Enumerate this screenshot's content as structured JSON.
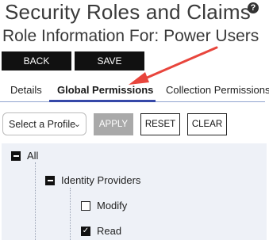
{
  "header": {
    "title": "Security Roles and Claims",
    "help_icon": "?",
    "subtitle": "Role Information For: Power Users"
  },
  "actions": {
    "back_label": "BACK",
    "save_label": "SAVE"
  },
  "tabs": [
    {
      "label": "Details",
      "active": false
    },
    {
      "label": "Global Permissions",
      "active": true
    },
    {
      "label": "Collection Permissions",
      "active": false
    }
  ],
  "toolbar": {
    "profile_select_value": "Select a Profile",
    "apply_label": "APPLY",
    "reset_label": "RESET",
    "clear_label": "CLEAR"
  },
  "tree": {
    "root": {
      "label": "All",
      "state": "expanded"
    },
    "group": {
      "label": "Identity Providers",
      "state": "expanded"
    },
    "items": [
      {
        "label": "Modify",
        "checked": false
      },
      {
        "label": "Read",
        "checked": true
      }
    ]
  },
  "colors": {
    "accent": "#3548a8",
    "annotation_arrow": "#e8453c",
    "tree_background": "#eef1f7",
    "disabled_button": "#a9a9a9"
  }
}
